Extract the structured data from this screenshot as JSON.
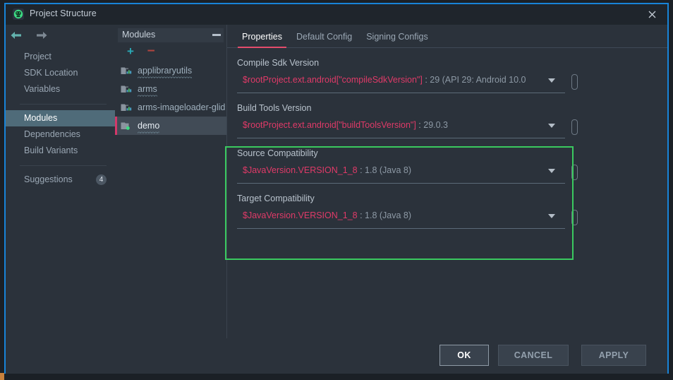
{
  "window": {
    "title": "Project Structure",
    "app_icon": "android-studio-icon",
    "close_label": "✕"
  },
  "nav": {
    "back_icon": "arrow-left-icon",
    "forward_icon": "arrow-right-icon"
  },
  "sidebar": {
    "items": [
      {
        "label": "Project",
        "selected": false
      },
      {
        "label": "SDK Location",
        "selected": false
      },
      {
        "label": "Variables",
        "selected": false
      },
      {
        "label": "Modules",
        "selected": true
      },
      {
        "label": "Dependencies",
        "selected": false
      },
      {
        "label": "Build Variants",
        "selected": false
      },
      {
        "label": "Suggestions",
        "selected": false,
        "badge": "4"
      }
    ]
  },
  "modules_panel": {
    "title": "Modules",
    "collapse_icon": "minimize-icon",
    "add_label": "+",
    "remove_label": "−",
    "rows": [
      {
        "label": "applibraryutils",
        "icon": "library-module-icon",
        "selected": false,
        "squiggle": true
      },
      {
        "label": "arms",
        "icon": "library-module-icon",
        "selected": false,
        "squiggle": true
      },
      {
        "label": "arms-imageloader-glid",
        "icon": "library-module-icon",
        "selected": false,
        "squiggle": false
      },
      {
        "label": "demo",
        "icon": "app-module-icon",
        "selected": true,
        "squiggle": true
      }
    ]
  },
  "tabs": [
    {
      "label": "Properties",
      "active": true
    },
    {
      "label": "Default Config",
      "active": false
    },
    {
      "label": "Signing Configs",
      "active": false
    }
  ],
  "form": {
    "fields": [
      {
        "label": "Compile Sdk Version",
        "ref": "$rootProject.ext.android[\"compileSdkVersion\"]",
        "sep": " : ",
        "resolved": "29 (API 29: Android 10.0",
        "caret_icon": "chevron-down-icon",
        "pin_icon": "variable-button-icon"
      },
      {
        "label": "Build Tools Version",
        "ref": "$rootProject.ext.android[\"buildToolsVersion\"]",
        "sep": " : ",
        "resolved": "29.0.3",
        "caret_icon": "chevron-down-icon",
        "pin_icon": "variable-button-icon"
      },
      {
        "label": "Source Compatibility",
        "ref": "$JavaVersion.VERSION_1_8",
        "sep": " : ",
        "resolved": "1.8 (Java 8)",
        "caret_icon": "chevron-down-icon",
        "pin_icon": "variable-button-icon"
      },
      {
        "label": "Target Compatibility",
        "ref": "$JavaVersion.VERSION_1_8",
        "sep": " : ",
        "resolved": "1.8 (Java 8)",
        "caret_icon": "chevron-down-icon",
        "pin_icon": "variable-button-icon"
      }
    ]
  },
  "footer": {
    "ok": "OK",
    "cancel": "CANCEL",
    "apply": "APPLY"
  },
  "colors": {
    "accent_blue_border": "#1884d8",
    "tab_active_underline": "#e34c6c",
    "variable_ref_text": "#e03a68",
    "annotation_green": "#3ac95f",
    "selection_slate": "#4f6b79",
    "module_marker_pink": "#d4386a",
    "add_icon_teal": "#2aa8b5",
    "scrollbar_maroon": "#54304a"
  }
}
